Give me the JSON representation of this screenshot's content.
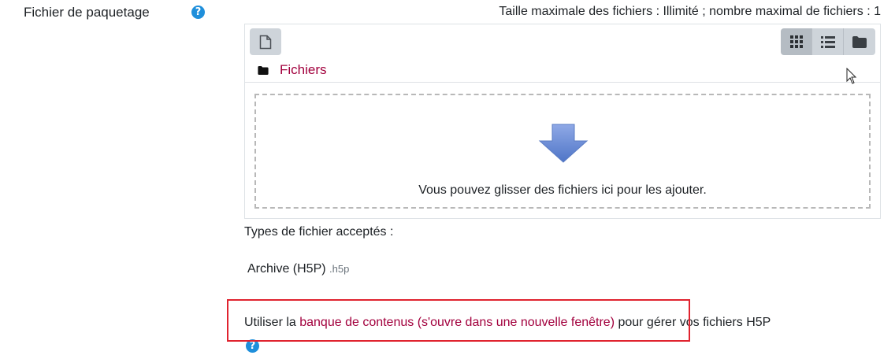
{
  "field": {
    "label": "Fichier de paquetage",
    "help_glyph": "?"
  },
  "limits_text": "Taille maximale des fichiers : Illimité ; nombre maximal de fichiers : 1",
  "filepicker": {
    "toolbar": {
      "add_file_icon": "file-icon",
      "view_icons": [
        "grid-icon",
        "list-icon",
        "folder-icon"
      ]
    },
    "path": {
      "folder_icon": "folder-icon",
      "label": "Fichiers"
    },
    "dropzone": {
      "icon": "download-arrow-icon",
      "message": "Vous pouvez glisser des fichiers ici pour les ajouter."
    }
  },
  "accepted": {
    "title": "Types de fichier acceptés :",
    "items": [
      {
        "name": "Archive (H5P)",
        "ext": ".h5p"
      }
    ]
  },
  "content_bank": {
    "prefix": "Utiliser la ",
    "link": "banque de contenus (s'ouvre dans une nouvelle fenêtre)",
    "suffix": " pour gérer vos fichiers H5P",
    "help_glyph": "?"
  },
  "colors": {
    "link": "#a2003d",
    "help": "#1f8fdb",
    "highlight": "#e0232f"
  }
}
